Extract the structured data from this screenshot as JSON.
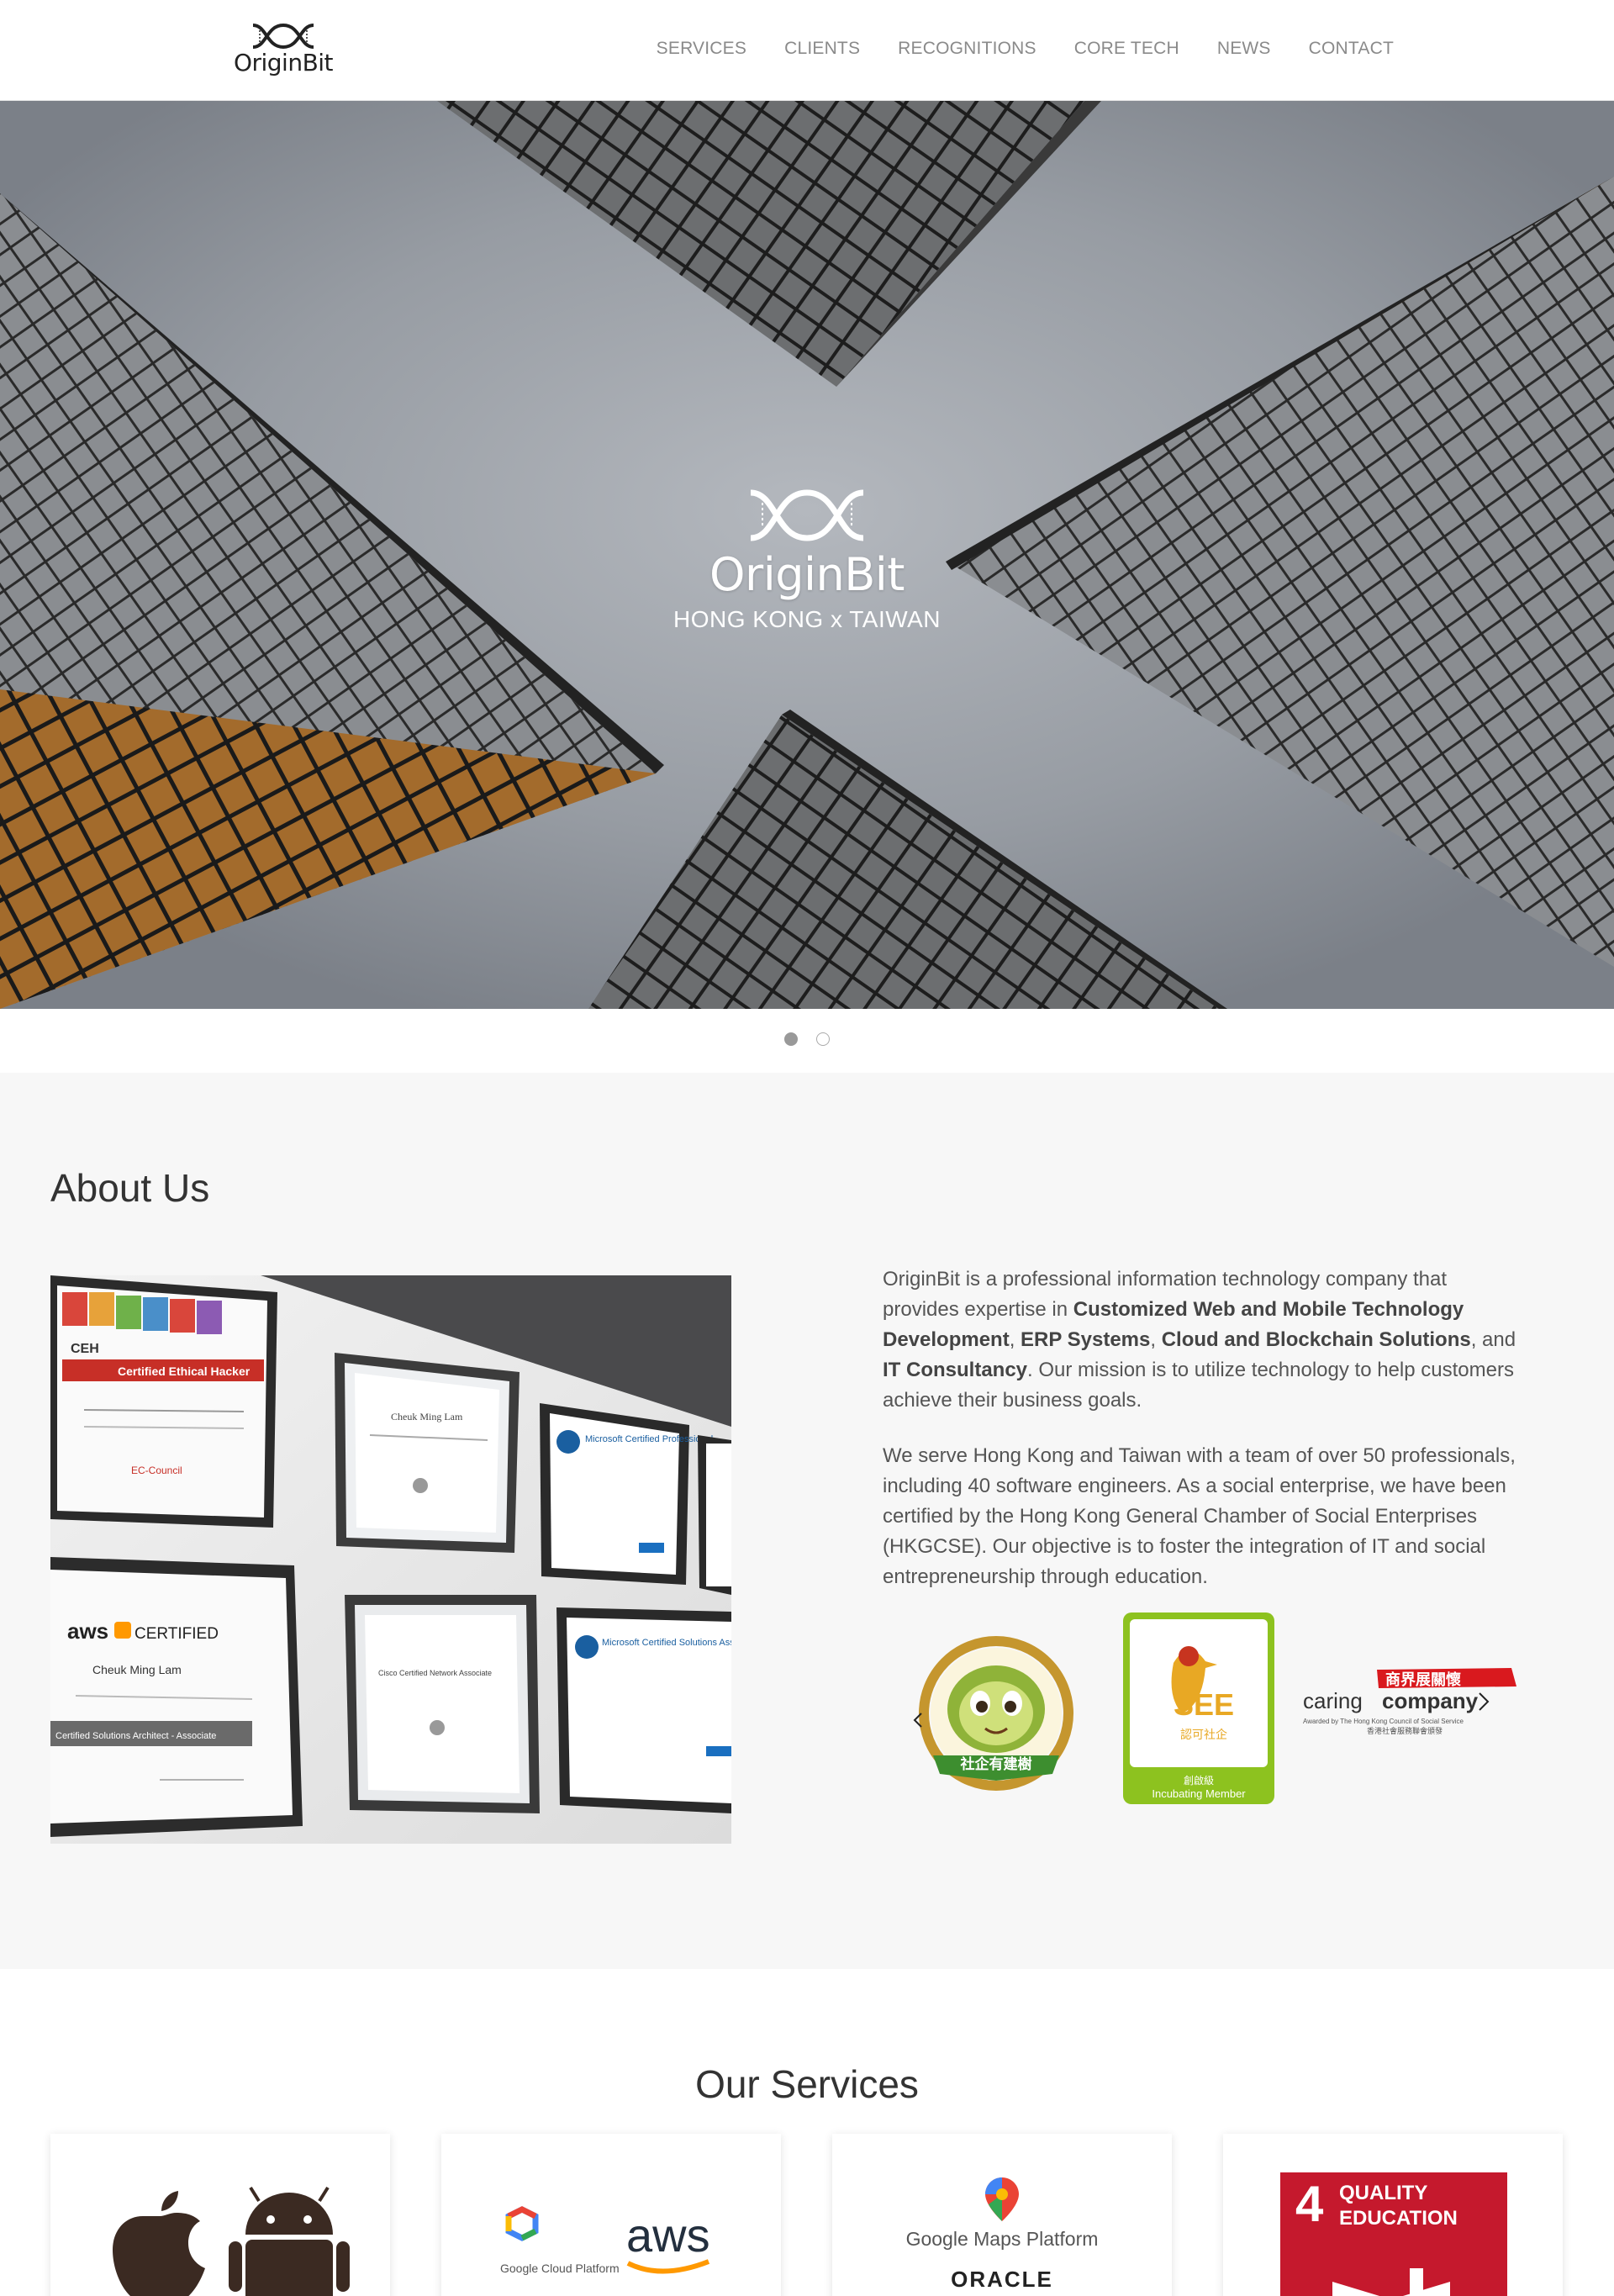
{
  "brand": {
    "name": "OriginBit"
  },
  "nav": {
    "items": [
      "SERVICES",
      "CLIENTS",
      "RECOGNITIONS",
      "CORE TECH",
      "NEWS",
      "CONTACT"
    ]
  },
  "hero": {
    "logo_word": "OriginBit",
    "subtitle": "HONG KONG x TAIWAN",
    "slides": 2,
    "active_slide": 1
  },
  "about": {
    "title": "About Us",
    "p1_a": "OriginBit is a professional information technology company that provides expertise in ",
    "p1_b": "Customized Web and Mobile Technology Development",
    "p1_c": ", ",
    "p1_d": "ERP Systems",
    "p1_e": ", ",
    "p1_f": "Cloud and Blockchain Solutions",
    "p1_g": ", and ",
    "p1_h": "IT Consultancy",
    "p1_i": ". Our mission is to utilize technology to help customers achieve their business goals.",
    "p2": "We serve Hong Kong and Taiwan with a team of over 50 professionals, including 40 software engineers. As a social enterprise, we have been certified by the Hong Kong General Chamber of Social Enterprises (HKGCSE). Our objective is to foster the integration of IT and social entrepreneurship through education.",
    "photo": {
      "cert1_title": "Certified Ethical Hacker",
      "cert1_org": "EC-Council",
      "cert2_brand": "aws",
      "cert2_label": "CERTIFIED",
      "cert2_name": "Cheuk Ming Lam",
      "cert2_role": "Certified Solutions Architect - Associate",
      "cert3_name": "Cheuk Ming Lam",
      "cert4_title": "Microsoft Certified Professional",
      "cert5_title": "Microsoft Certified Solutions Associate",
      "cert6_title": "Cisco Certified Network Associate",
      "ceh_tag": "CEH"
    },
    "badges": {
      "b1_text": "社企有建樹",
      "b2_top": "SEE",
      "b2_cn": "認可社企",
      "b2_level": "創啟級",
      "b2_label": "Incubating Member",
      "b3_cn": "商界展關懷",
      "b3_word_a": "caring",
      "b3_word_b": "company",
      "b3_sub": "Awarded by The Hong Kong Council of Social Service",
      "b3_sub_cn": "香港社會服務聯會頒發"
    }
  },
  "services": {
    "title": "Our Services",
    "card3_a": "Google Maps Platform",
    "card3_b": "ORACLE",
    "card2_a": "aws",
    "card2_b": "Google Cloud Platform",
    "card4_num": "4",
    "card4_a": "QUALITY",
    "card4_b": "EDUCATION"
  },
  "colors": {
    "sdg4_red": "#c5192d",
    "see_green": "#8dc21f",
    "aws_orange": "#ff9900"
  }
}
